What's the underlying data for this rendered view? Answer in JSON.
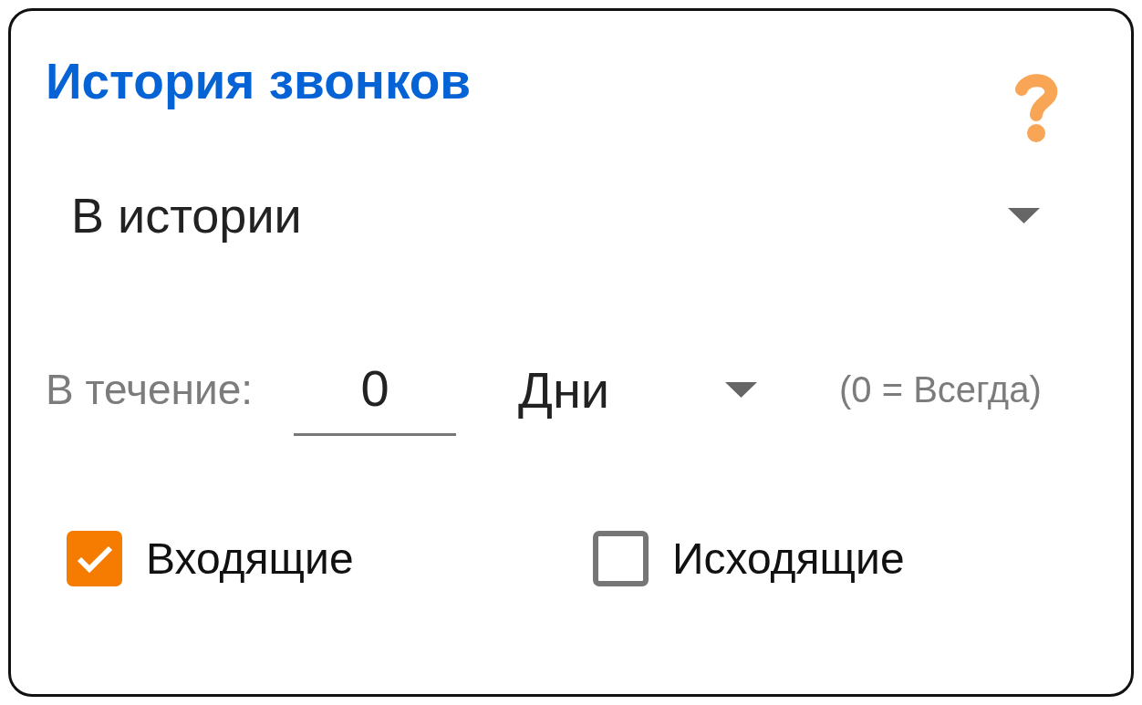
{
  "title": "История звонков",
  "scope_select": {
    "value": "В истории"
  },
  "period": {
    "label": "В течение:",
    "value": "0",
    "unit_select": {
      "value": "Дни"
    },
    "hint": "(0 = Всегда)"
  },
  "checkboxes": [
    {
      "label": "Входящие",
      "checked": true
    },
    {
      "label": "Исходящие",
      "checked": false
    }
  ]
}
